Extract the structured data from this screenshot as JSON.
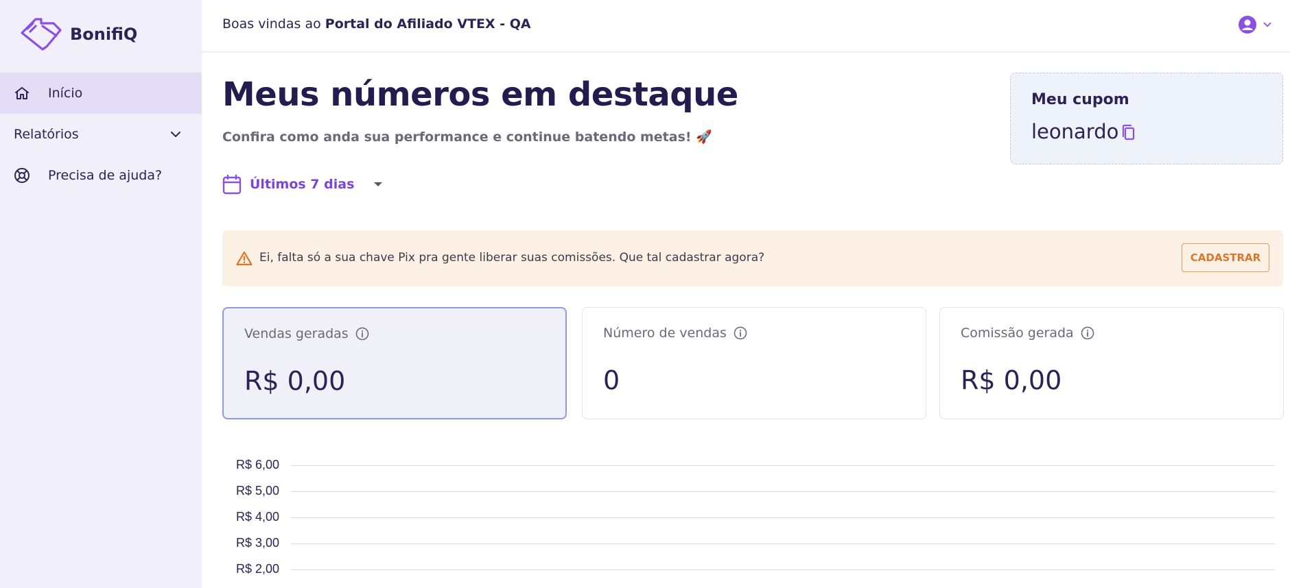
{
  "brand": {
    "name": "BonifiQ",
    "accent": "#7b46d8"
  },
  "sidebar": {
    "items": [
      {
        "label": "Início",
        "icon": "home-icon",
        "active": true
      },
      {
        "label": "Relatórios",
        "icon": "chevron-down-icon",
        "active": false
      },
      {
        "label": "Precisa de ajuda?",
        "icon": "lifebuoy-icon",
        "active": false
      }
    ]
  },
  "header": {
    "welcome_prefix": "Boas vindas ao",
    "portal_name": "Portal do Afiliado VTEX - QA",
    "user_icon": "user-circle-icon"
  },
  "main": {
    "title": "Meus números em destaque",
    "subtitle": "Confira como anda sua performance e continue batendo metas! 🚀"
  },
  "coupon": {
    "title": "Meu cupom",
    "code": "leonardo"
  },
  "date_filter": {
    "selected": "Últimos 7 dias"
  },
  "alert": {
    "message": "Ei, falta só a sua chave Pix pra gente liberar suas comissões. Que tal cadastrar agora?",
    "button": "CADASTRAR"
  },
  "cards": [
    {
      "title": "Vendas geradas",
      "value": "R$ 0,00",
      "selected": true
    },
    {
      "title": "Número de vendas",
      "value": "0",
      "selected": false
    },
    {
      "title": "Comissão gerada",
      "value": "R$ 0,00",
      "selected": false
    }
  ],
  "chart_data": {
    "type": "line",
    "y_tick_labels": [
      "R$ 6,00",
      "R$ 5,00",
      "R$ 4,00",
      "R$ 3,00",
      "R$ 2,00"
    ],
    "y_ticks": [
      6,
      5,
      4,
      3,
      2
    ],
    "grid": true
  }
}
